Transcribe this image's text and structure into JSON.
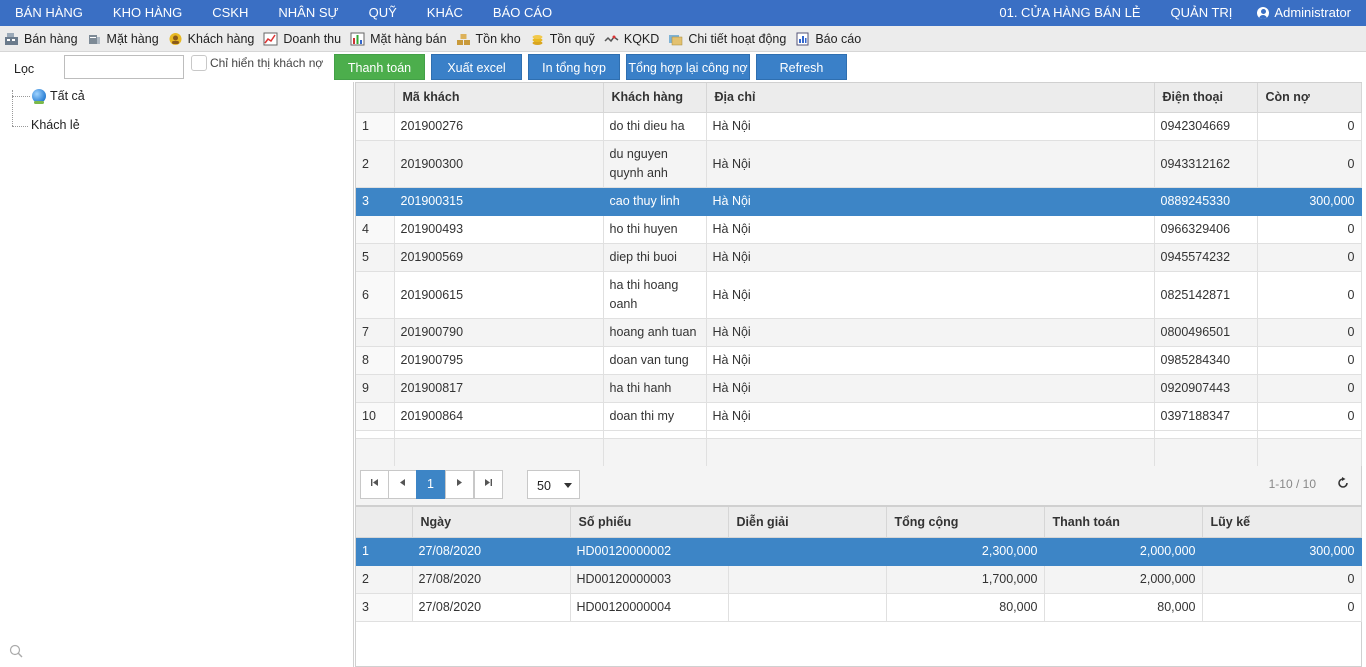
{
  "topnav": {
    "menus": [
      "BÁN HÀNG",
      "KHO HÀNG",
      "CSKH",
      "NHÂN SỰ",
      "QUỸ",
      "KHÁC",
      "BÁO CÁO"
    ],
    "store": "01. CỬA HÀNG BÁN LẺ",
    "admin_menu": "QUẢN TRỊ",
    "user": "Administrator"
  },
  "toolbar": {
    "items": [
      {
        "label": "Bán hàng",
        "icon": "cash-register-icon"
      },
      {
        "label": "Mặt hàng",
        "icon": "box-icon"
      },
      {
        "label": "Khách hàng",
        "icon": "customer-icon"
      },
      {
        "label": "Doanh thu",
        "icon": "revenue-chart-icon"
      },
      {
        "label": "Mặt hàng bán",
        "icon": "bar-chart-icon"
      },
      {
        "label": "Tồn kho",
        "icon": "stock-icon"
      },
      {
        "label": "Tồn quỹ",
        "icon": "coins-icon"
      },
      {
        "label": "KQKD",
        "icon": "trend-icon"
      },
      {
        "label": "Chi tiết hoạt động",
        "icon": "activity-icon"
      },
      {
        "label": "Báo cáo",
        "icon": "report-icon"
      }
    ]
  },
  "filter": {
    "label": "Lọc",
    "value": "",
    "debt_only_label": "Chỉ hiển thị khách nợ",
    "buttons": {
      "pay": "Thanh toán",
      "export": "Xuất excel",
      "print": "In tổng hợp",
      "recalc": "Tổng hợp lại công nợ",
      "refresh": "Refresh"
    }
  },
  "tree": {
    "all": "Tất cả",
    "retail": "Khách lẻ"
  },
  "customers": {
    "columns": [
      "",
      "Mã khách",
      "Khách hàng",
      "Địa chỉ",
      "Điện thoại",
      "Còn nợ"
    ],
    "rows": [
      {
        "idx": "1",
        "code": "201900276",
        "name": "do thi dieu ha",
        "address": "Hà Nội",
        "phone": "0942304669",
        "debt": "0"
      },
      {
        "idx": "2",
        "code": "201900300",
        "name": "du nguyen quynh anh",
        "address": "Hà Nội",
        "phone": "0943312162",
        "debt": "0"
      },
      {
        "idx": "3",
        "code": "201900315",
        "name": "cao thuy linh",
        "address": "Hà Nội",
        "phone": "0889245330",
        "debt": "300,000"
      },
      {
        "idx": "4",
        "code": "201900493",
        "name": "ho thi huyen",
        "address": "Hà Nội",
        "phone": "0966329406",
        "debt": "0"
      },
      {
        "idx": "5",
        "code": "201900569",
        "name": "diep thi buoi",
        "address": "Hà Nội",
        "phone": "0945574232",
        "debt": "0"
      },
      {
        "idx": "6",
        "code": "201900615",
        "name": "ha thi hoang oanh",
        "address": "Hà Nội",
        "phone": "0825142871",
        "debt": "0"
      },
      {
        "idx": "7",
        "code": "201900790",
        "name": "hoang anh tuan",
        "address": "Hà Nội",
        "phone": "0800496501",
        "debt": "0"
      },
      {
        "idx": "8",
        "code": "201900795",
        "name": "doan van tung",
        "address": "Hà Nội",
        "phone": "0985284340",
        "debt": "0"
      },
      {
        "idx": "9",
        "code": "201900817",
        "name": "ha thi hanh",
        "address": "Hà Nội",
        "phone": "0920907443",
        "debt": "0"
      },
      {
        "idx": "10",
        "code": "201900864",
        "name": "doan thi my",
        "address": "Hà Nội",
        "phone": "0397188347",
        "debt": "0"
      }
    ]
  },
  "pager": {
    "current_page": "1",
    "page_size": "50",
    "info": "1-10 / 10"
  },
  "transactions": {
    "columns": [
      "",
      "Ngày",
      "Số phiếu",
      "Diễn giải",
      "Tổng cộng",
      "Thanh toán",
      "Lũy kế"
    ],
    "rows": [
      {
        "idx": "1",
        "date": "27/08/2020",
        "voucher": "HD00120000002",
        "desc": "",
        "total": "2,300,000",
        "paid": "2,000,000",
        "cumulative": "300,000"
      },
      {
        "idx": "2",
        "date": "27/08/2020",
        "voucher": "HD00120000003",
        "desc": "",
        "total": "1,700,000",
        "paid": "2,000,000",
        "cumulative": "0"
      },
      {
        "idx": "3",
        "date": "27/08/2020",
        "voucher": "HD00120000004",
        "desc": "",
        "total": "80,000",
        "paid": "80,000",
        "cumulative": "0"
      }
    ]
  }
}
